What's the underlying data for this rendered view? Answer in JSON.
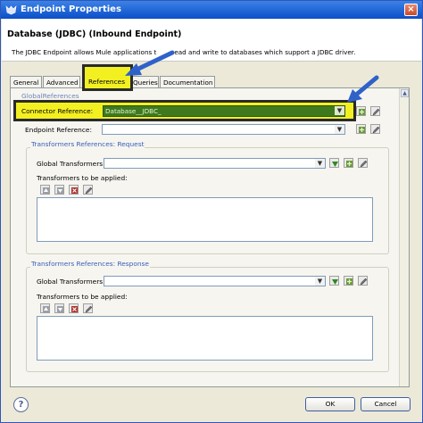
{
  "window": {
    "title": "Endpoint Properties",
    "close_glyph": "×"
  },
  "header": {
    "title": "Database (JDBC) (Inbound Endpoint)",
    "description_left": "The JDBC Endpoint allows Mule applications t",
    "description_right": "ead and write to databases which support a JDBC driver."
  },
  "tabs": [
    {
      "label": "General"
    },
    {
      "label": "Advanced"
    },
    {
      "label": "References",
      "active": true
    },
    {
      "label": "Queries"
    },
    {
      "label": "Documentation"
    }
  ],
  "global_references": {
    "group_label": "GlobalReferences",
    "connector_label": "Connector Reference:",
    "connector_value": "Database__JDBC_",
    "endpoint_label": "Endpoint Reference:",
    "endpoint_value": ""
  },
  "request": {
    "group_label": "Transformers References: Request",
    "global_label": "Global Transformers:",
    "global_value": "",
    "applied_label": "Transformers to be applied:"
  },
  "response": {
    "group_label": "Transformers References: Response",
    "global_label": "Global Transformers:",
    "global_value": "",
    "applied_label": "Transformers to be applied:"
  },
  "footer": {
    "help_glyph": "?",
    "ok_label": "OK",
    "cancel_label": "Cancel"
  },
  "icons": {
    "window": "mule-icon",
    "add": "add-icon",
    "edit": "edit-icon",
    "move_down": "move-down-icon",
    "up": "move-up-icon",
    "delete": "delete-icon",
    "dropdown": "chevron-down-icon",
    "scroll_up": "scroll-up-icon"
  },
  "colors": {
    "highlight": "#f3f022",
    "connector_field": "#3e7a1d",
    "annotation_arrow": "#2f62c9",
    "group_label": "#3b60b8"
  }
}
